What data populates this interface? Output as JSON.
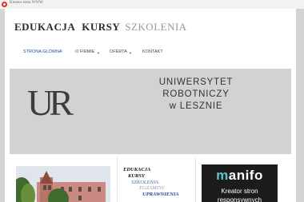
{
  "topbar": {
    "label": "Kreator stron WWW"
  },
  "header": {
    "title_word1": "EDUKACJA",
    "title_word2": "KURSY",
    "title_word3": "SZKOLENIA"
  },
  "nav": {
    "items": [
      {
        "label": "STRONA GŁÓWNA",
        "dropdown": false
      },
      {
        "label": "O FIRMIE",
        "dropdown": true
      },
      {
        "label": "OFERTA",
        "dropdown": true
      },
      {
        "label": "KONTAKT",
        "dropdown": false
      }
    ]
  },
  "banner": {
    "logo_text": "UR",
    "line1": "UNIWERSYTET  ROBOTNICZY",
    "line2": "w  LESZNIE"
  },
  "tags": {
    "items": [
      {
        "text": "EDUKACJA",
        "color": "#111111"
      },
      {
        "text": "KURSY",
        "color": "#111111"
      },
      {
        "text": "SZKOLENIA",
        "color": "#3b6fb6"
      },
      {
        "text": "EGZAMINY",
        "color": "#9a9a9a"
      },
      {
        "text": "UPRAWNIENIA",
        "color": "#1a3f9a"
      }
    ]
  },
  "ad": {
    "brand_m": "m",
    "brand_rest": "anifo",
    "line1": "Kreator stron",
    "line2": "responsywnych"
  },
  "colors": {
    "nav_active": "#1f4fa0",
    "brand_accent": "#5cc3c9"
  }
}
